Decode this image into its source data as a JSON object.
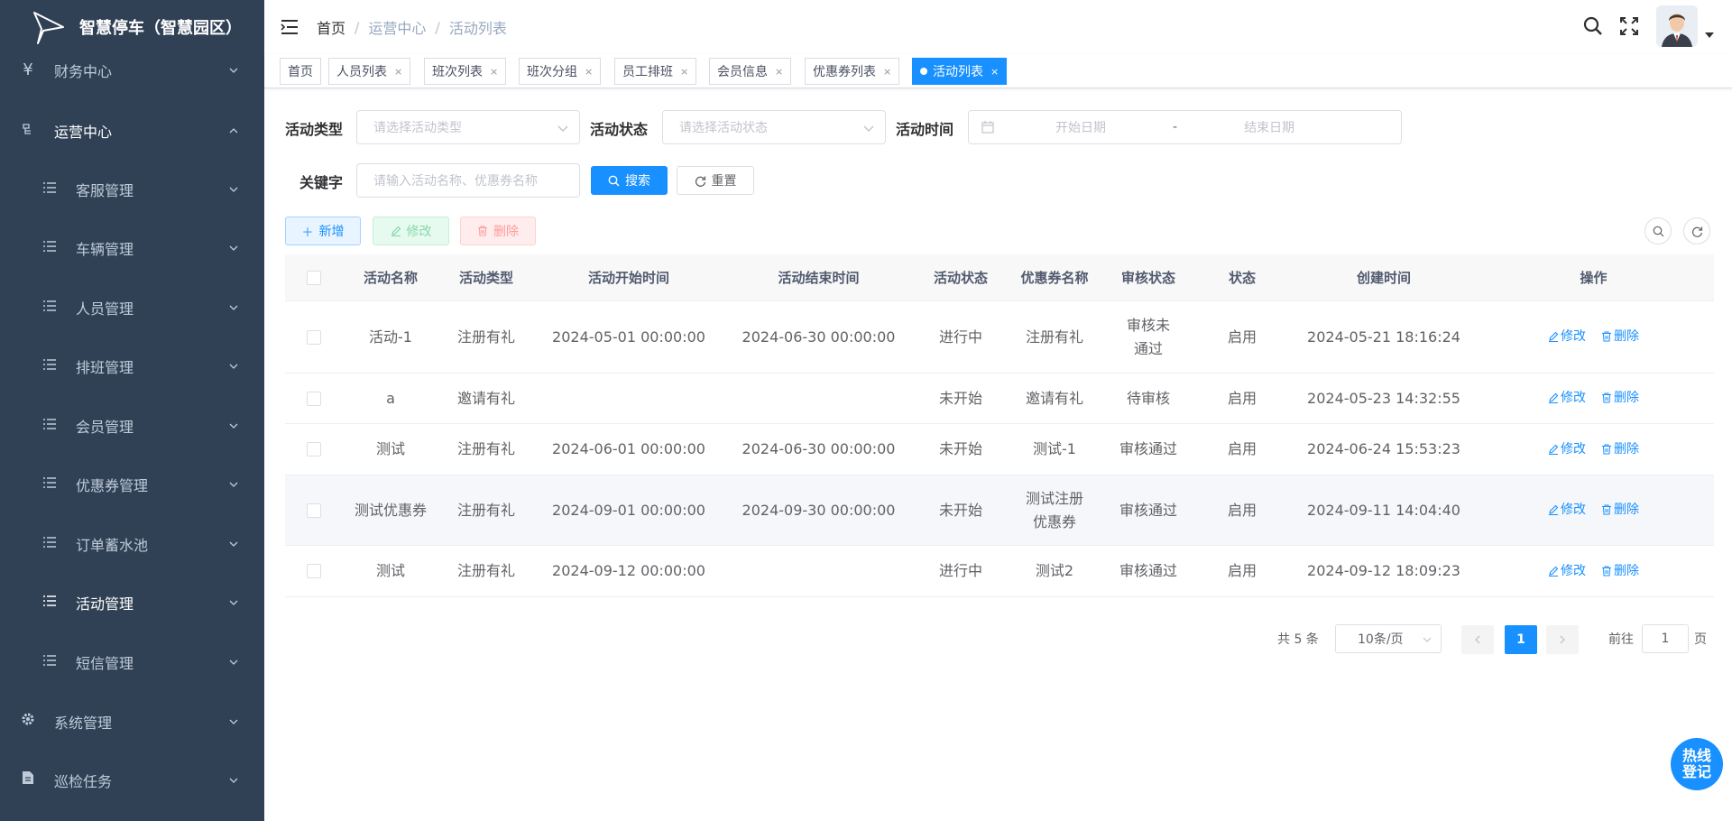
{
  "app": {
    "title": "智慧停车（智慧园区）"
  },
  "sidebar": {
    "items": [
      {
        "label": "财务中心",
        "icon": "yen-icon"
      },
      {
        "label": "运营中心",
        "icon": "tree-icon"
      },
      {
        "label": "客服管理",
        "icon": "list-icon"
      },
      {
        "label": "车辆管理",
        "icon": "list-icon"
      },
      {
        "label": "人员管理",
        "icon": "list-icon"
      },
      {
        "label": "排班管理",
        "icon": "list-icon"
      },
      {
        "label": "会员管理",
        "icon": "list-icon"
      },
      {
        "label": "优惠券管理",
        "icon": "list-icon"
      },
      {
        "label": "订单蓄水池",
        "icon": "list-icon"
      },
      {
        "label": "活动管理",
        "icon": "list-icon"
      },
      {
        "label": "短信管理",
        "icon": "list-icon"
      },
      {
        "label": "系统管理",
        "icon": "gear-icon"
      },
      {
        "label": "巡检任务",
        "icon": "document-icon"
      }
    ]
  },
  "breadcrumb": [
    "首页",
    "运营中心",
    "活动列表"
  ],
  "breadcrumb_sep": "/",
  "tags": [
    {
      "label": "首页",
      "closable": false
    },
    {
      "label": "人员列表",
      "closable": true
    },
    {
      "label": "班次列表",
      "closable": true
    },
    {
      "label": "班次分组",
      "closable": true
    },
    {
      "label": "员工排班",
      "closable": true
    },
    {
      "label": "会员信息",
      "closable": true
    },
    {
      "label": "优惠券列表",
      "closable": true
    },
    {
      "label": "活动列表",
      "closable": true,
      "active": true
    }
  ],
  "tag_close": "×",
  "filters": {
    "type_label": "活动类型",
    "type_placeholder": "请选择活动类型",
    "status_label": "活动状态",
    "status_placeholder": "请选择活动状态",
    "time_label": "活动时间",
    "start_placeholder": "开始日期",
    "range_sep": "-",
    "end_placeholder": "结束日期",
    "keyword_label": "关键字",
    "keyword_placeholder": "请输入活动名称、优惠券名称",
    "search_button": "搜索",
    "reset_button": "重置"
  },
  "toolbar": {
    "add": "新增",
    "edit": "修改",
    "delete": "删除"
  },
  "table": {
    "columns": [
      "活动名称",
      "活动类型",
      "活动开始时间",
      "活动结束时间",
      "活动状态",
      "优惠券名称",
      "审核状态",
      "状态",
      "创建时间",
      "操作"
    ],
    "rows": [
      {
        "name": "活动-1",
        "type": "注册有礼",
        "start": "2024-05-01 00:00:00",
        "end": "2024-06-30 00:00:00",
        "status": "进行中",
        "coupon": "注册有礼",
        "audit": "审核未通过",
        "enabled": "启用",
        "created": "2024-05-21 18:16:24"
      },
      {
        "name": "a",
        "type": "邀请有礼",
        "start": "",
        "end": "",
        "status": "未开始",
        "coupon": "邀请有礼",
        "audit": "待审核",
        "enabled": "启用",
        "created": "2024-05-23 14:32:55"
      },
      {
        "name": "测试",
        "type": "注册有礼",
        "start": "2024-06-01 00:00:00",
        "end": "2024-06-30 00:00:00",
        "status": "未开始",
        "coupon": "测试-1",
        "audit": "审核通过",
        "enabled": "启用",
        "created": "2024-06-24 15:53:23"
      },
      {
        "name": "测试优惠券",
        "type": "注册有礼",
        "start": "2024-09-01 00:00:00",
        "end": "2024-09-30 00:00:00",
        "status": "未开始",
        "coupon": "测试注册优惠券",
        "audit": "审核通过",
        "enabled": "启用",
        "created": "2024-09-11 14:04:40"
      },
      {
        "name": "测试",
        "type": "注册有礼",
        "start": "2024-09-12 00:00:00",
        "end": "",
        "status": "进行中",
        "coupon": "测试2",
        "audit": "审核通过",
        "enabled": "启用",
        "created": "2024-09-12 18:09:23"
      }
    ],
    "op_edit": "修改",
    "op_delete": "删除"
  },
  "pagination": {
    "total": "共 5 条",
    "page_size": "10条/页",
    "current": "1",
    "goto_prefix": "前往",
    "goto_value": "1",
    "goto_suffix": "页"
  },
  "hotline": {
    "line1": "热线",
    "line2": "登记"
  },
  "colors": {
    "sidebar_bg": "#304156",
    "primary": "#1890ff"
  }
}
